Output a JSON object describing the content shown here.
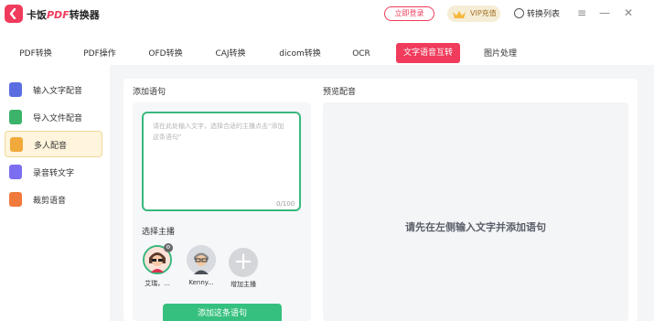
{
  "app": {
    "title_prefix": "卡饭",
    "title_brand": "PDF",
    "title_suffix": "转换器"
  },
  "header": {
    "login_label": "立即登录",
    "vip_label": "VIP充值",
    "convert_list_label": "转换列表"
  },
  "tabs": [
    {
      "label": "PDF转换"
    },
    {
      "label": "PDF操作"
    },
    {
      "label": "OFD转换"
    },
    {
      "label": "CAJ转换"
    },
    {
      "label": "dicom转换"
    },
    {
      "label": "OCR"
    },
    {
      "label": "文字语音互转",
      "active": true
    },
    {
      "label": "图片处理"
    }
  ],
  "sidebar": {
    "items": [
      {
        "label": "输入文字配音",
        "icon": "text-voice-icon",
        "color": "#5b6ee1"
      },
      {
        "label": "导入文件配音",
        "icon": "file-voice-icon",
        "color": "#3bb36a"
      },
      {
        "label": "多人配音",
        "icon": "multi-voice-icon",
        "color": "#f2a93b",
        "active": true
      },
      {
        "label": "录音转文字",
        "icon": "record-text-icon",
        "color": "#7b6ef0"
      },
      {
        "label": "裁剪语音",
        "icon": "cut-audio-icon",
        "color": "#f07a3b"
      }
    ]
  },
  "main": {
    "add_label": "添加语句",
    "preview_label": "预览配音",
    "placeholder": "请在此处输入文字，选择合适的主播点击\"添加这条语句\"",
    "counter": "0/100",
    "choose_anchor_label": "选择主播",
    "anchors": [
      {
        "name": "艾瑞，..."
      },
      {
        "name": "Kenny..."
      }
    ],
    "add_anchor_label": "增加主播",
    "add_sentence_button": "添加这条语句",
    "preview_message": "请先在左侧输入文字并添加语句"
  },
  "colors": {
    "accent": "#f03b5c",
    "green": "#36c07f",
    "vip_bg": "#f6edd6"
  }
}
